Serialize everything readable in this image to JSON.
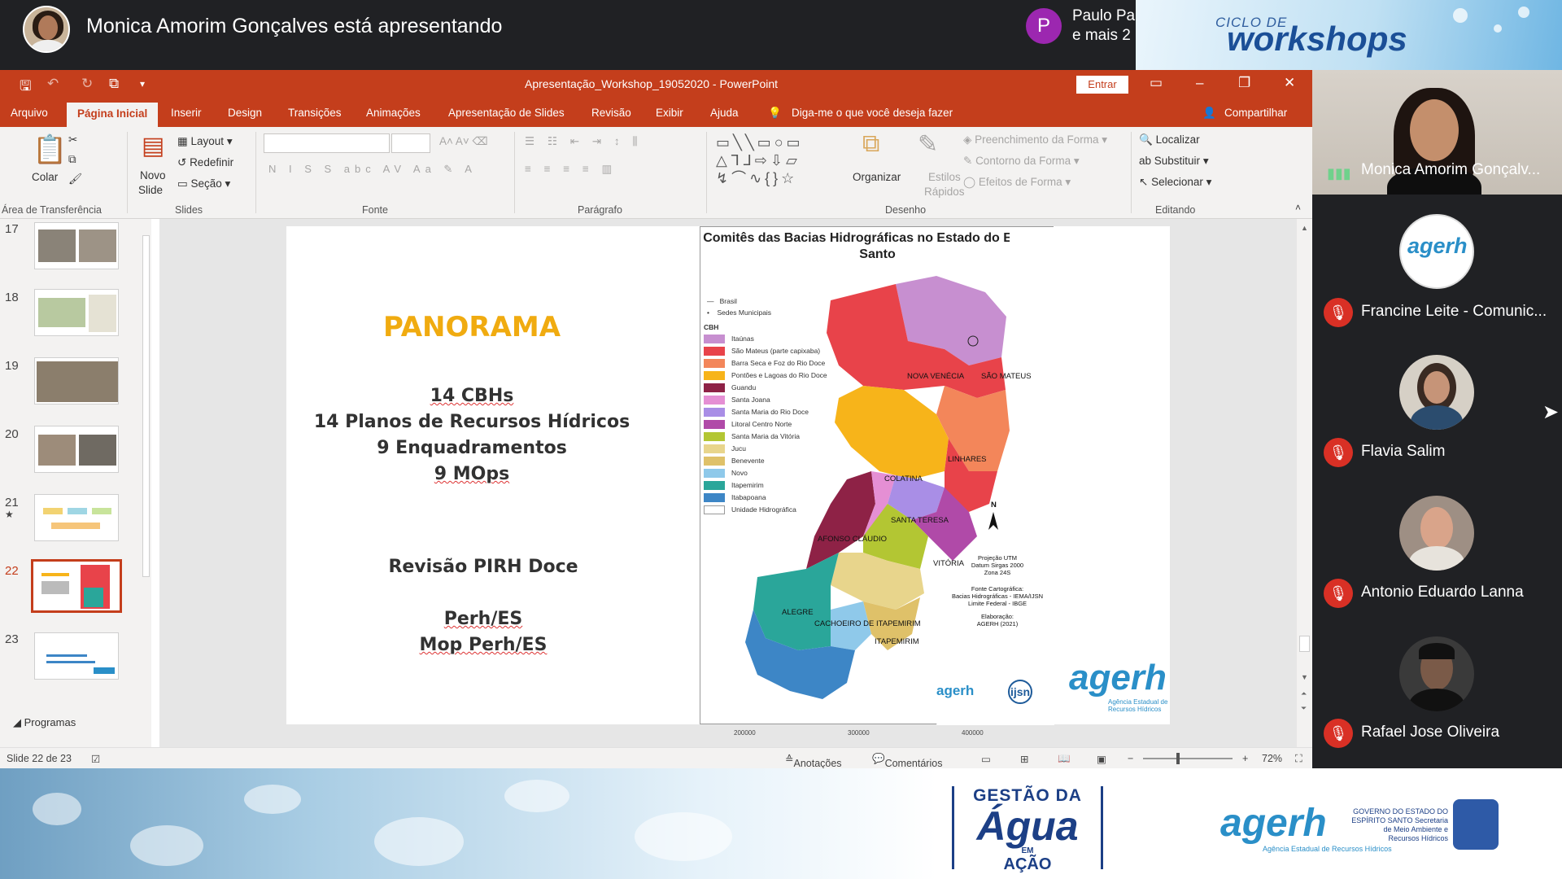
{
  "meet": {
    "presenter_text": "Monica Amorim Gonçalves está apresentando",
    "others_initial": "P",
    "others_name": "Paulo Pa",
    "others_more": "e mais 2",
    "banner_sub": "CICLO DE",
    "banner_main": "workshops"
  },
  "ppt": {
    "title": "Apresentação_Workshop_19052020 - PowerPoint",
    "signin": "Entrar",
    "tabs": [
      "Arquivo",
      "Página Inicial",
      "Inserir",
      "Design",
      "Transições",
      "Animações",
      "Apresentação de Slides",
      "Revisão",
      "Exibir",
      "Ajuda"
    ],
    "tellme": "Diga-me o que você deseja fazer",
    "share": "Compartilhar",
    "ribbon": {
      "colar": "Colar",
      "novo": "Novo",
      "slide": "Slide",
      "layout": "Layout",
      "redefinir": "Redefinir",
      "secao": "Seção",
      "organizar": "Organizar",
      "estilos": "Estilos",
      "rapidos": "Rápidos",
      "preenchimento": "Preenchimento da Forma",
      "contorno": "Contorno da Forma",
      "efeitos": "Efeitos de Forma",
      "localizar": "Localizar",
      "substituir": "Substituir",
      "selecionar": "Selecionar"
    },
    "groups": {
      "clipboard": "Área de Transferência",
      "slides": "Slides",
      "fonte": "Fonte",
      "paragrafo": "Parágrafo",
      "desenho": "Desenho",
      "editando": "Editando"
    },
    "thumbs": [
      "17",
      "18",
      "19",
      "20",
      "21",
      "22",
      "23"
    ],
    "thumb_star": "★",
    "sections": "Programas",
    "status": {
      "slide": "Slide 22 de 23",
      "notes": "Anotações",
      "comments": "Comentários",
      "zoom": "72%"
    }
  },
  "slide": {
    "heading": "PANORAMA",
    "lines": [
      "14 CBHs",
      "14 Planos de Recursos Hídricos",
      "9 Enquadramentos",
      "9 MOps"
    ],
    "revisao": "Revisão PIRH Doce",
    "perh": "Perh/ES",
    "mop": "Mop Perh/ES",
    "logo": "agerh",
    "logo_sub": "Agência Estadual de Recursos Hídricos"
  },
  "map": {
    "title": "Comitês das Bacias Hidrográficas no Estado do Espírito Santo",
    "legend_top": [
      "Brasil",
      "Sedes Municipais",
      "CBH"
    ],
    "legend": [
      {
        "name": "Itaúnas",
        "color": "#c78fd0"
      },
      {
        "name": "São Mateus (parte capixaba)",
        "color": "#e8434a"
      },
      {
        "name": "Barra Seca e Foz do Rio Doce",
        "color": "#f3865a"
      },
      {
        "name": "Pontões e Lagoas do Rio Doce",
        "color": "#f7b41a"
      },
      {
        "name": "Guandu",
        "color": "#8e2246"
      },
      {
        "name": "Santa Joana",
        "color": "#e58fd4"
      },
      {
        "name": "Santa Maria do Rio Doce",
        "color": "#a98ee6"
      },
      {
        "name": "Litoral Centro Norte",
        "color": "#b04aa8"
      },
      {
        "name": "Santa Maria da Vitória",
        "color": "#b3c633"
      },
      {
        "name": "Jucu",
        "color": "#e8d58c"
      },
      {
        "name": "Benevente",
        "color": "#dfc169"
      },
      {
        "name": "Novo",
        "color": "#8fc9ea"
      },
      {
        "name": "Itapemirim",
        "color": "#2aa69a"
      },
      {
        "name": "Itabapoana",
        "color": "#3d86c6"
      },
      {
        "name": "Unidade Hidrográfica",
        "color": "#ffffff"
      }
    ],
    "cities": [
      "NOVA VENÉCIA",
      "SÃO MATEUS",
      "LINHARES",
      "COLATINA",
      "SANTA TERESA",
      "AFONSO CLÁUDIO",
      "VITÓRIA",
      "ALEGRE",
      "CACHOEIRO DE ITAPEMIRIM",
      "ITAPEMIRIM"
    ],
    "north": "N",
    "proj": [
      "Projeção UTM",
      "Datum Sirgas 2000",
      "Zona 24S"
    ],
    "source": [
      "Fonte Cartográfica:",
      "Bacias Hidrográficas - IEMA/IJSN",
      "Limite Federal - IBGE"
    ],
    "elab": [
      "Elaboração:",
      "AGERH (2021)"
    ],
    "xticks": [
      "200000",
      "300000",
      "400000"
    ],
    "logos": [
      "agerh",
      "ijsn"
    ]
  },
  "participants": {
    "big": "Monica Amorim Gonçalv...",
    "list": [
      {
        "name": "Francine Leite - Comunic..."
      },
      {
        "name": "Flavia Salim"
      },
      {
        "name": "Antonio Eduardo Lanna"
      },
      {
        "name": "Rafael Jose Oliveira"
      }
    ],
    "agerh_avatar": "agerh"
  },
  "banner": {
    "gestao1": "GESTÃO DA",
    "gestao2": "Água",
    "gestao3": "EM",
    "gestao4": "AÇÃO",
    "agerh": "agerh",
    "agerh_sub": "Agência Estadual de Recursos Hídricos",
    "gov": "GOVERNO DO ESTADO DO ESPÍRITO SANTO Secretaria de Meio Ambiente e Recursos Hídricos"
  }
}
